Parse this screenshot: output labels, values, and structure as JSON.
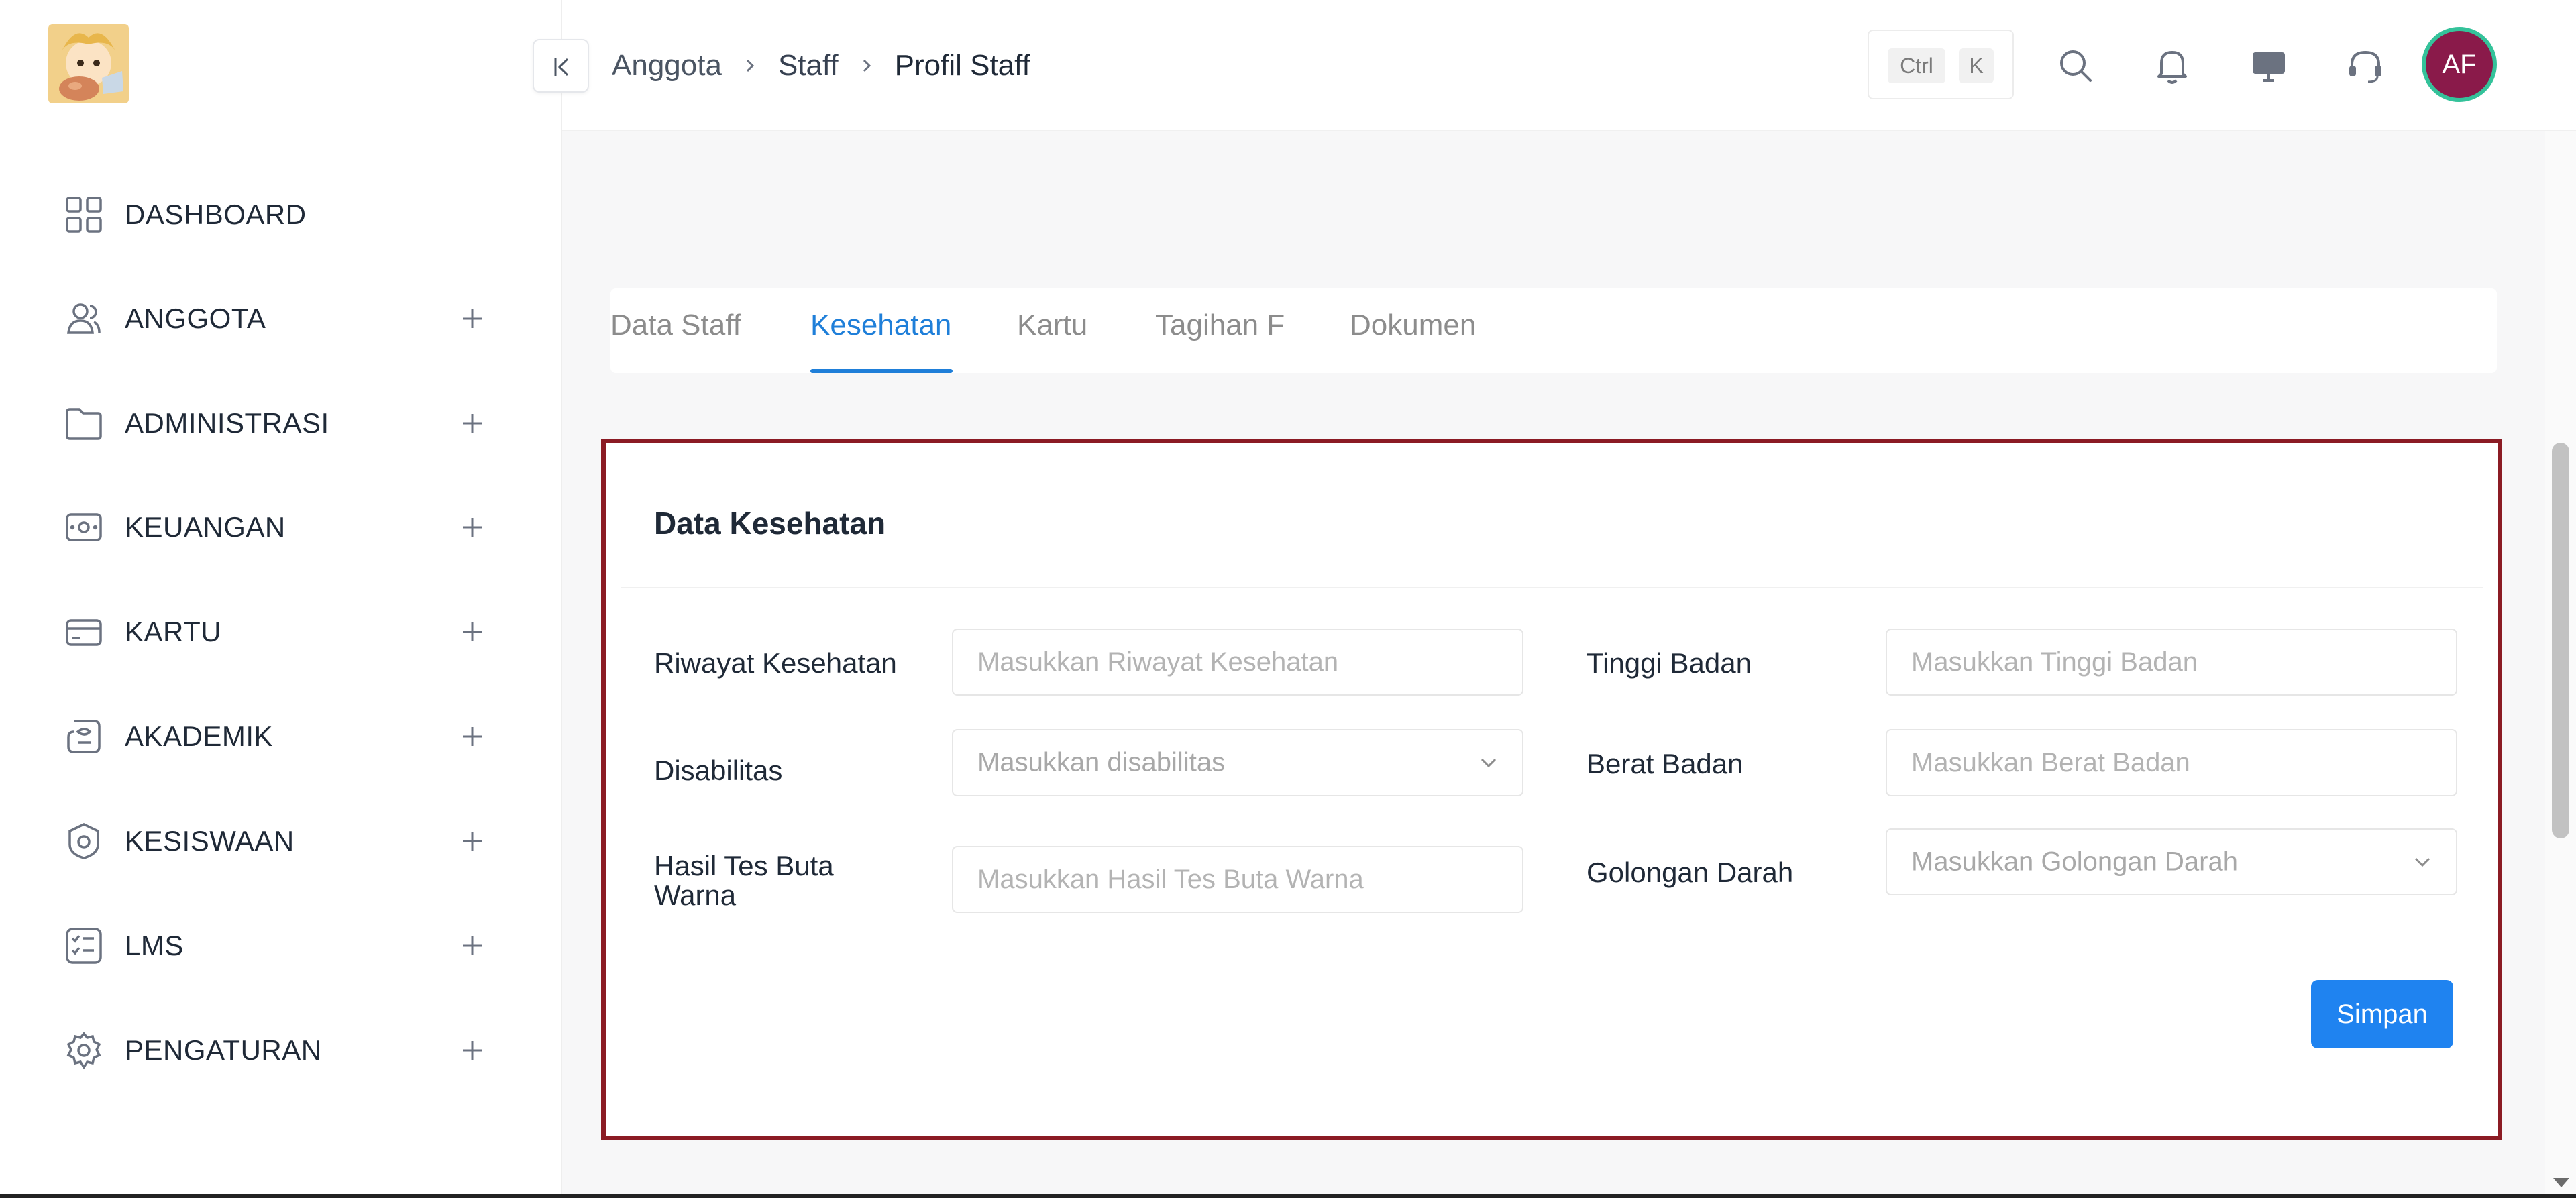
{
  "sidebar": {
    "items": [
      {
        "label": "DASHBOARD",
        "icon": "dashboard-grid-icon",
        "expandable": false
      },
      {
        "label": "ANGGOTA",
        "icon": "users-icon",
        "expandable": true
      },
      {
        "label": "ADMINISTRASI",
        "icon": "folder-icon",
        "expandable": true
      },
      {
        "label": "KEUANGAN",
        "icon": "wallet-icon",
        "expandable": true
      },
      {
        "label": "KARTU",
        "icon": "card-icon",
        "expandable": true
      },
      {
        "label": "AKADEMIK",
        "icon": "academic-icon",
        "expandable": true
      },
      {
        "label": "KESISWAAN",
        "icon": "badge-icon",
        "expandable": true
      },
      {
        "label": "LMS",
        "icon": "checklist-icon",
        "expandable": true
      },
      {
        "label": "PENGATURAN",
        "icon": "gear-icon",
        "expandable": true
      }
    ]
  },
  "header": {
    "breadcrumb": [
      "Anggota",
      "Staff",
      "Profil Staff"
    ],
    "shortcut": {
      "ctrl": "Ctrl",
      "key": "K"
    },
    "icons": [
      "search-icon",
      "bell-icon",
      "monitor-icon",
      "headset-icon"
    ],
    "avatar_initials": "AF"
  },
  "tabs": [
    {
      "label": "Data Staff",
      "active": false
    },
    {
      "label": "Kesehatan",
      "active": true
    },
    {
      "label": "Kartu",
      "active": false
    },
    {
      "label": "Tagihan F",
      "active": false
    },
    {
      "label": "Dokumen",
      "active": false
    }
  ],
  "card": {
    "title": "Data Kesehatan",
    "fields": {
      "riwayat": {
        "label": "Riwayat Kesehatan",
        "placeholder": "Masukkan Riwayat Kesehatan",
        "value": ""
      },
      "disabilitas": {
        "label": "Disabilitas",
        "placeholder": "Masukkan disabilitas"
      },
      "buta_warna": {
        "label": "Hasil Tes Buta Warna",
        "placeholder": "Masukkan Hasil Tes Buta Warna",
        "value": ""
      },
      "tinggi": {
        "label": "Tinggi Badan",
        "placeholder": "Masukkan Tinggi Badan",
        "value": ""
      },
      "berat": {
        "label": "Berat Badan",
        "placeholder": "Masukkan Berat Badan",
        "value": ""
      },
      "golongan": {
        "label": "Golongan Darah",
        "placeholder": "Masukkan Golongan Darah"
      }
    },
    "save_label": "Simpan"
  },
  "colors": {
    "accent": "#1f7fd9",
    "button": "#1f83f0",
    "highlight_border": "#8b1b24",
    "avatar_bg": "#8a1a4a",
    "avatar_ring": "#34c29a"
  }
}
